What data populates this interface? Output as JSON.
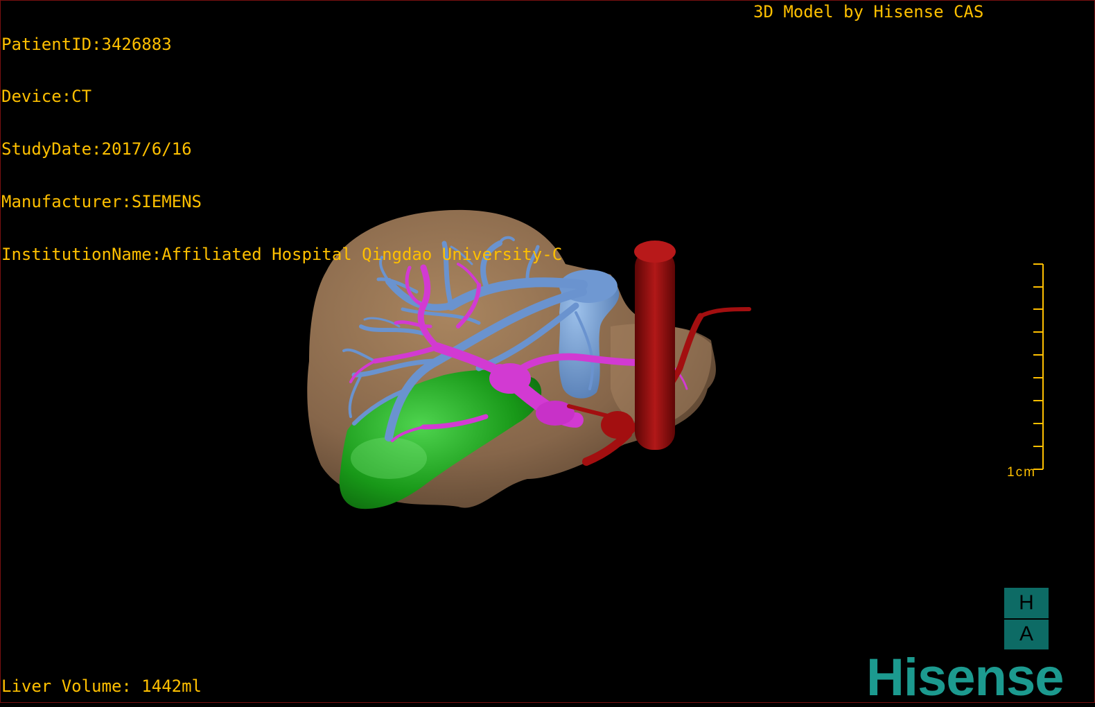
{
  "overlay": {
    "patient_id": "PatientID:3426883",
    "device": "Device:CT",
    "study_date": "StudyDate:2017/6/16",
    "manufacturer": "Manufacturer:SIEMENS",
    "institution": "InstitutionName:Affiliated Hospital Qingdao University-C",
    "model_credit": "3D Model by Hisense CAS",
    "liver_volume": "Liver Volume: 1442ml"
  },
  "scale_bar": {
    "label": "1cm"
  },
  "logos": {
    "ha_top": "H",
    "ha_bottom": "A",
    "brand": "Hisense"
  },
  "colors": {
    "overlay_text": "#ffc000",
    "liver": "#8a6a4a",
    "hepatic_vein": "#5b86c4",
    "portal_vein": "#c83ac8",
    "artery": "#9a0f10",
    "gallbladder": "#1f9a1f",
    "brand": "#1c9a8f"
  }
}
